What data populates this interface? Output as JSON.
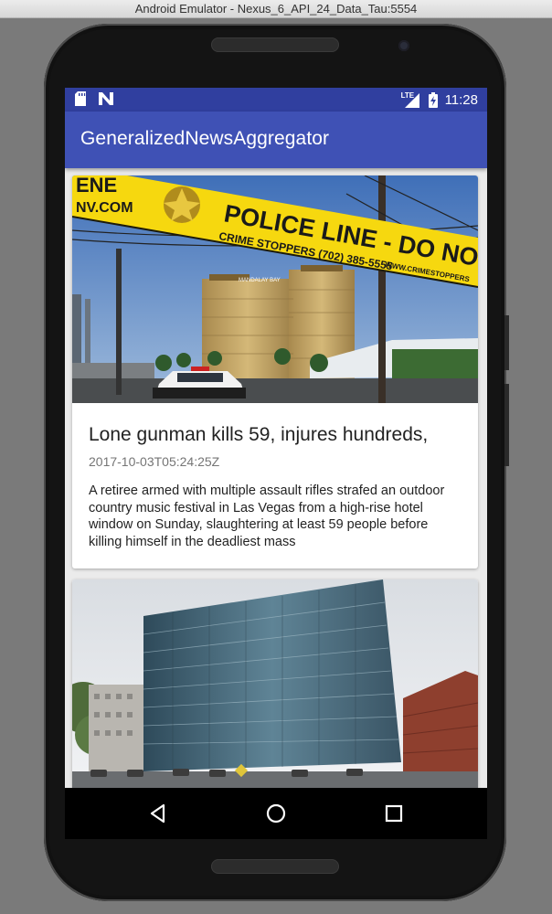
{
  "window": {
    "title": "Android Emulator - Nexus_6_API_24_Data_Tau:5554"
  },
  "status_bar": {
    "icons_left": [
      "sd-card-icon",
      "n-notification-icon"
    ],
    "network": "LTE",
    "icons_right": [
      "signal-icon",
      "battery-charging-icon"
    ],
    "time": "11:28"
  },
  "app_bar": {
    "title": "GeneralizedNewsAggregator"
  },
  "articles": [
    {
      "title": "Lone gunman kills 59, injures hundreds,",
      "date": "2017-10-03T05:24:25Z",
      "description": "A retiree armed with multiple assault rifles strafed an outdoor country music festival in Las Vegas from a high-rise hotel window on Sunday, slaughtering at least 59 people before killing himself in the deadliest mass",
      "image_text": [
        "POLICE LINE - DO NOT CROSS - CRIME",
        "CRIME STOPPERS (702) 385-5555",
        "WWW.CRIMESTOPPERS",
        "ENE",
        "NV.COM",
        "MANDALAY BAY"
      ]
    },
    {
      "title": "",
      "date": "",
      "description": "",
      "image_text": []
    }
  ],
  "nav_bar": {
    "back": "back-icon",
    "home": "home-icon",
    "recents": "recents-icon"
  },
  "colors": {
    "primary": "#3f51b5",
    "primary_dark": "#303f9f",
    "background": "#ebebeb"
  }
}
